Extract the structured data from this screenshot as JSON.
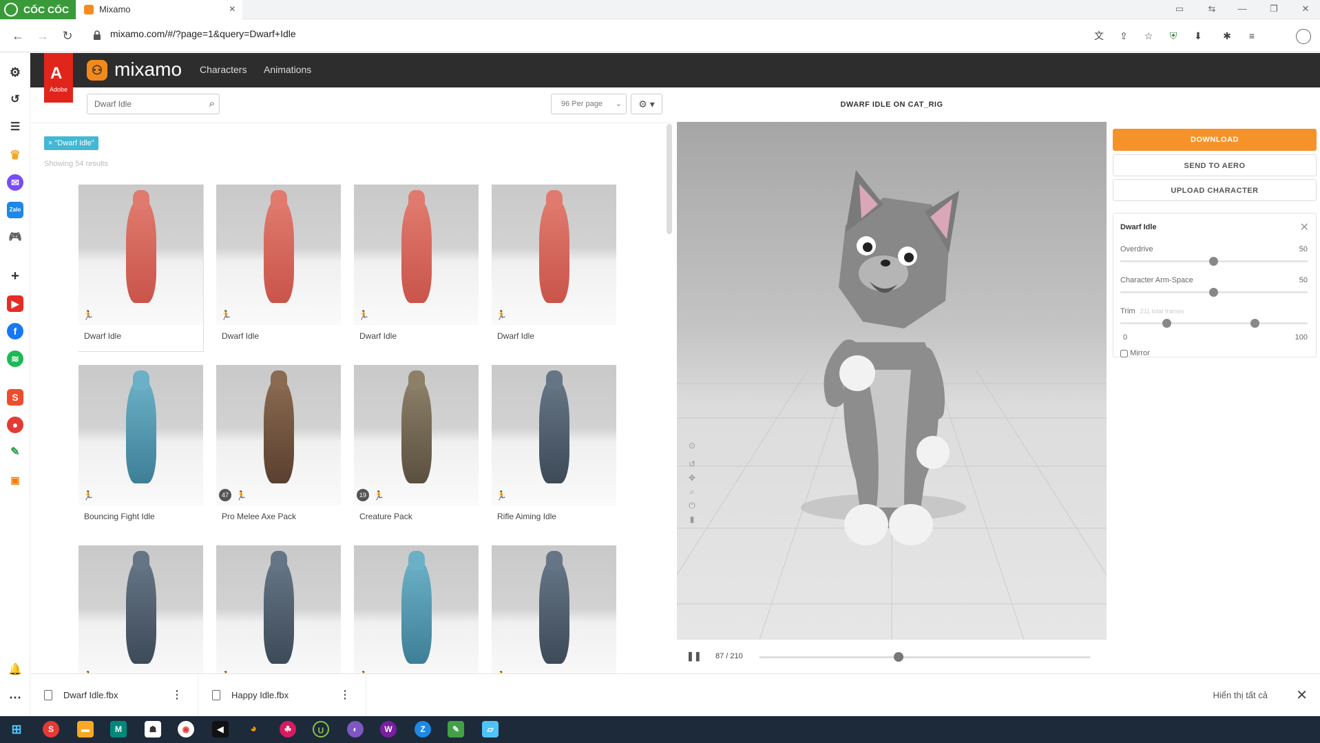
{
  "browser": {
    "brand": "CỐC CỐC",
    "tab_title": "Mixamo",
    "url": "mixamo.com/#/?page=1&query=Dwarf+Idle"
  },
  "header": {
    "adobe_label": "Adobe",
    "logo_text": "mixamo",
    "nav": [
      "Characters",
      "Animations"
    ]
  },
  "search": {
    "value": "Dwarf Idle",
    "per_page": "96 Per page",
    "filter_tag": "× \"Dwarf Idle\"",
    "showing": "Showing 54 results"
  },
  "results": [
    {
      "label": "Dwarf Idle",
      "badge": "",
      "kind": "red"
    },
    {
      "label": "Dwarf Idle",
      "badge": "",
      "kind": "red"
    },
    {
      "label": "Dwarf Idle",
      "badge": "",
      "kind": "red"
    },
    {
      "label": "Dwarf Idle",
      "badge": "",
      "kind": "red"
    },
    {
      "label": "Bouncing Fight Idle",
      "badge": "",
      "kind": "blue"
    },
    {
      "label": "Pro Melee Axe Pack",
      "badge": "47",
      "kind": "brown"
    },
    {
      "label": "Creature Pack",
      "badge": "19",
      "kind": "creature"
    },
    {
      "label": "Rifle Aiming Idle",
      "badge": "",
      "kind": "soldier"
    },
    {
      "label": "",
      "badge": "",
      "kind": "soldier"
    },
    {
      "label": "",
      "badge": "",
      "kind": "soldier"
    },
    {
      "label": "",
      "badge": "",
      "kind": "blue"
    },
    {
      "label": "",
      "badge": "",
      "kind": "soldier"
    }
  ],
  "viewer": {
    "title": "DWARF IDLE ON CAT_RIG",
    "frame_display": "87 / 210",
    "progress": 0.42
  },
  "panel": {
    "download": "DOWNLOAD",
    "send_to_aero": "SEND TO AERO",
    "upload": "UPLOAD CHARACTER",
    "anim_name": "Dwarf Idle",
    "overdrive_label": "Overdrive",
    "overdrive_value": "50",
    "armspace_label": "Character Arm-Space",
    "armspace_value": "50",
    "trim_label": "Trim",
    "trim_note": "211 total frames",
    "trim_min": "0",
    "trim_max": "100",
    "mirror_label": "Mirror"
  },
  "downloads": {
    "items": [
      "Dwarf Idle.fbx",
      "Happy Idle.fbx"
    ],
    "show_all": "Hiển thị tất cả"
  },
  "colors": {
    "accent": "#f5922a",
    "tag": "#42b8d5",
    "header": "#2d2d2d",
    "adobe": "#e1251b"
  }
}
